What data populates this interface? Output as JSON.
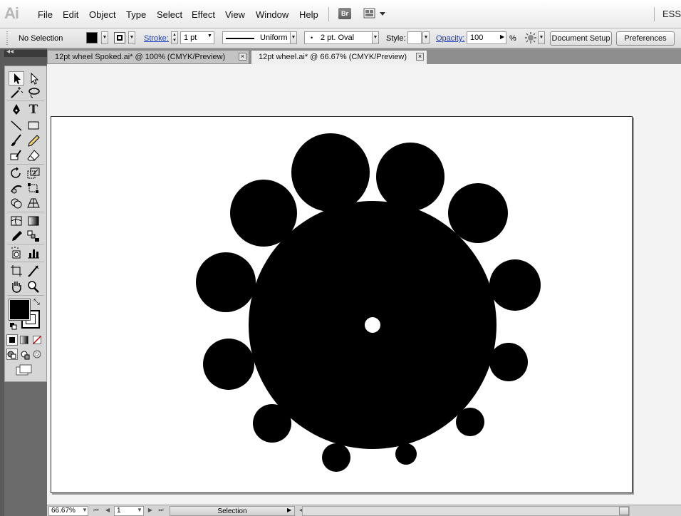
{
  "app": {
    "logo_text": "Ai",
    "bridge_label": "Br",
    "workspace_label": "ESSE"
  },
  "menu": [
    "File",
    "Edit",
    "Object",
    "Type",
    "Select",
    "Effect",
    "View",
    "Window",
    "Help"
  ],
  "control": {
    "selection_label": "No Selection",
    "stroke_label": "Stroke:",
    "stroke_weight": "1 pt",
    "profile_label": "Uniform",
    "brush_label": "2 pt. Oval",
    "style_label": "Style:",
    "opacity_label": "Opacity:",
    "opacity_value": "100",
    "opacity_unit": "%",
    "document_setup_label": "Document Setup",
    "preferences_label": "Preferences"
  },
  "tabs": [
    {
      "label": "12pt wheel  Spoked.ai* @ 100% (CMYK/Preview)",
      "active": false
    },
    {
      "label": "12pt wheel.ai* @ 66.67% (CMYK/Preview)",
      "active": true
    }
  ],
  "tools": {
    "icons": [
      "selection-tool-icon",
      "direct-selection-tool-icon",
      "magic-wand-tool-icon",
      "lasso-tool-icon",
      "pen-tool-icon",
      "type-tool-icon",
      "line-segment-tool-icon",
      "rectangle-tool-icon",
      "paintbrush-tool-icon",
      "pencil-tool-icon",
      "blob-brush-tool-icon",
      "eraser-tool-icon",
      "rotate-tool-icon",
      "scale-tool-icon",
      "warp-tool-icon",
      "free-transform-tool-icon",
      "shape-builder-tool-icon",
      "perspective-grid-tool-icon",
      "mesh-tool-icon",
      "gradient-tool-icon",
      "eyedropper-tool-icon",
      "blend-tool-icon",
      "symbol-sprayer-tool-icon",
      "column-graph-tool-icon",
      "artboard-tool-icon",
      "slice-tool-icon",
      "hand-tool-icon",
      "zoom-tool-icon"
    ],
    "fill_color": "#000000",
    "stroke_color": "#000000"
  },
  "status": {
    "zoom": "66.67%",
    "artboard_number": "1",
    "mode_label": "Selection"
  },
  "colors": {
    "accent": "#1a3fbf",
    "pasteboard": "#f3f3f3",
    "artboard": "#ffffff",
    "art": "#000000"
  }
}
